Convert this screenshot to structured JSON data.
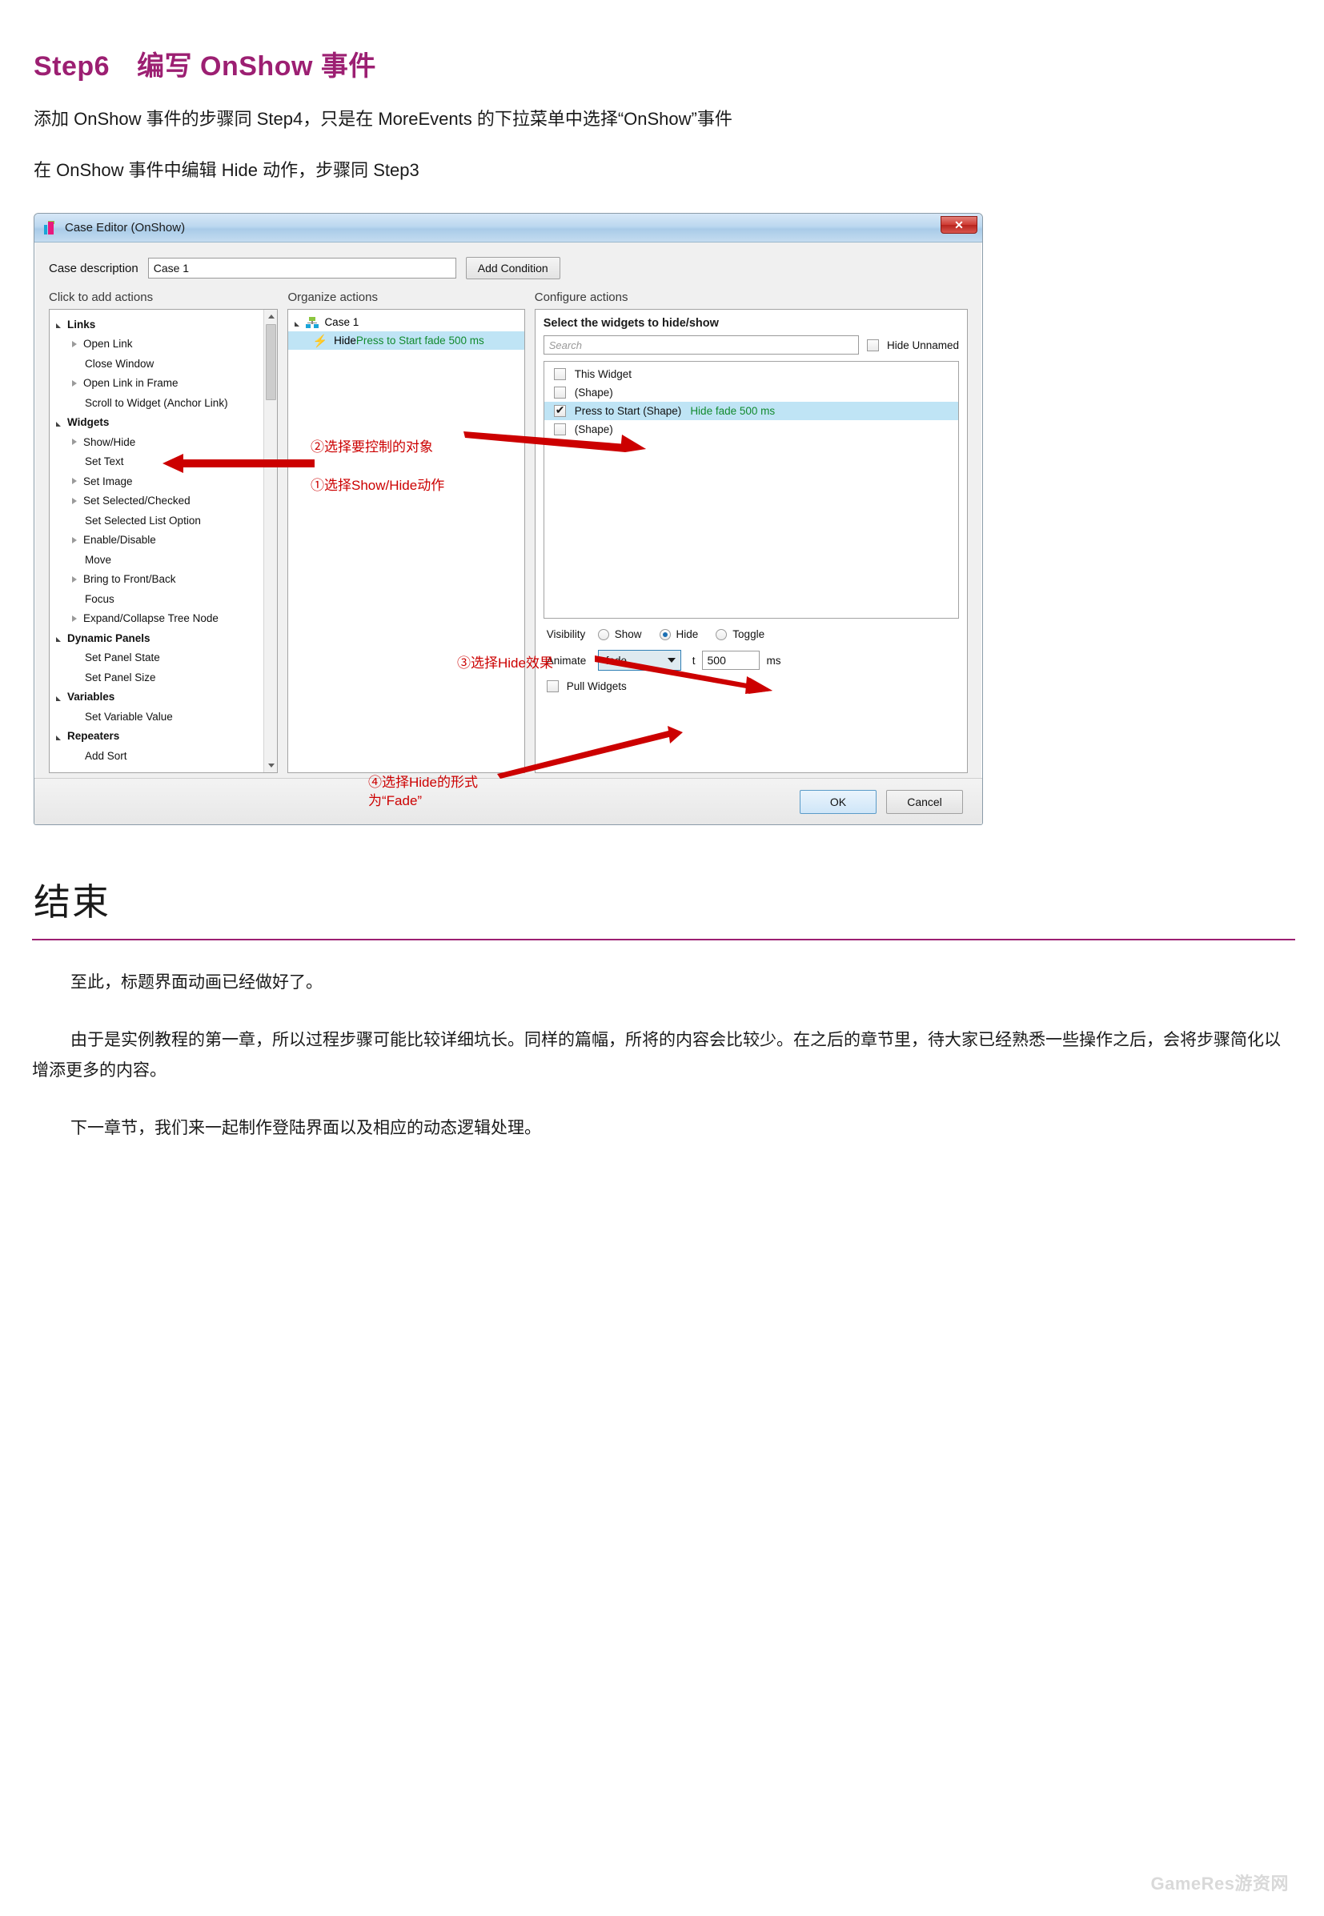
{
  "heading": {
    "step": "Step6",
    "title": "编写 OnShow 事件"
  },
  "intro": {
    "line1": "添加 OnShow 事件的步骤同 Step4，只是在 MoreEvents 的下拉菜单中选择“OnShow”事件",
    "line2": "在 OnShow 事件中编辑 Hide 动作，步骤同 Step3"
  },
  "dialog": {
    "title": "Case Editor (OnShow)",
    "close_label": "✕",
    "case_description_label": "Case description",
    "case_description_value": "Case 1",
    "add_condition_label": "Add Condition",
    "left": {
      "header": "Click to add actions",
      "items": [
        {
          "label": "Links",
          "type": "group"
        },
        {
          "label": "Open Link",
          "type": "expandable"
        },
        {
          "label": "Close Window",
          "type": "leaf"
        },
        {
          "label": "Open Link in Frame",
          "type": "expandable"
        },
        {
          "label": "Scroll to Widget (Anchor Link)",
          "type": "leaf"
        },
        {
          "label": "Widgets",
          "type": "group"
        },
        {
          "label": "Show/Hide",
          "type": "expandable"
        },
        {
          "label": "Set Text",
          "type": "leaf"
        },
        {
          "label": "Set Image",
          "type": "expandable"
        },
        {
          "label": "Set Selected/Checked",
          "type": "expandable"
        },
        {
          "label": "Set Selected List Option",
          "type": "leaf"
        },
        {
          "label": "Enable/Disable",
          "type": "expandable"
        },
        {
          "label": "Move",
          "type": "leaf"
        },
        {
          "label": "Bring to Front/Back",
          "type": "expandable"
        },
        {
          "label": "Focus",
          "type": "leaf"
        },
        {
          "label": "Expand/Collapse Tree Node",
          "type": "expandable"
        },
        {
          "label": "Dynamic Panels",
          "type": "group"
        },
        {
          "label": "Set Panel State",
          "type": "leaf"
        },
        {
          "label": "Set Panel Size",
          "type": "leaf"
        },
        {
          "label": "Variables",
          "type": "group"
        },
        {
          "label": "Set Variable Value",
          "type": "leaf"
        },
        {
          "label": "Repeaters",
          "type": "group"
        },
        {
          "label": "Add Sort",
          "type": "leaf"
        }
      ]
    },
    "middle": {
      "header": "Organize actions",
      "case_node": "Case 1",
      "action_prefix": "Hide ",
      "action_detail": "Press to Start fade 500 ms"
    },
    "right": {
      "header": "Configure actions",
      "panel_title": "Select the widgets to hide/show",
      "search_placeholder": "Search",
      "hide_unnamed_label": "Hide Unnamed",
      "hide_unnamed_checked": false,
      "widgets": [
        {
          "label": "This Widget",
          "suffix": "",
          "checked": false,
          "selected": false
        },
        {
          "label": "(Shape)",
          "suffix": "",
          "checked": false,
          "selected": false
        },
        {
          "label": "Press to Start (Shape)",
          "suffix": "Hide fade 500 ms",
          "checked": true,
          "selected": true
        },
        {
          "label": "(Shape)",
          "suffix": "",
          "checked": false,
          "selected": false
        }
      ],
      "visibility_label": "Visibility",
      "visibility_options": [
        "Show",
        "Hide",
        "Toggle"
      ],
      "visibility_selected": "Hide",
      "animate_label": "Animate",
      "animate_value": "fade",
      "time_label": "t",
      "time_value": "500",
      "time_unit": "ms",
      "pull_widgets_label": "Pull Widgets",
      "pull_widgets_checked": false
    },
    "footer": {
      "ok_label": "OK",
      "cancel_label": "Cancel"
    }
  },
  "annotations": {
    "a1": "①选择Show/Hide动作",
    "a2": "②选择要控制的对象",
    "a3": "③选择Hide效果",
    "a4": "④选择Hide的形式\n为“Fade”"
  },
  "end": {
    "title": "结束",
    "p1": "至此，标题界面动画已经做好了。",
    "p2": "由于是实例教程的第一章，所以过程步骤可能比较详细坑长。同样的篇幅，所将的内容会比较少。在之后的章节里，待大家已经熟悉一些操作之后，会将步骤简化以增添更多的内容。",
    "p3": "下一章节，我们来一起制作登陆界面以及相应的动态逻辑处理。"
  },
  "watermark": "GameRes游资网",
  "colors": {
    "accent": "#9c1f72",
    "annotation": "#cc0000",
    "selection": "#bfe4f5",
    "green_text": "#128a2e"
  }
}
